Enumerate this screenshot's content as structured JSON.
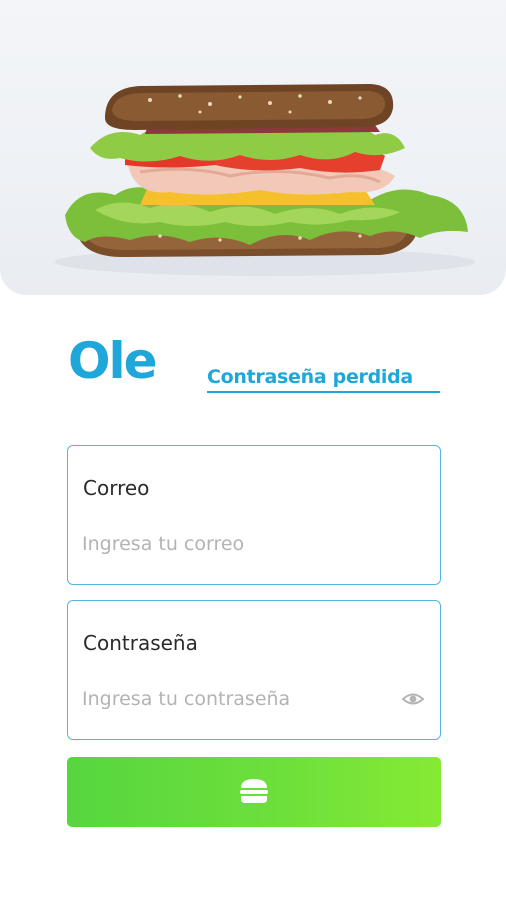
{
  "hero": {
    "image": "sandwich-photo"
  },
  "brand": {
    "logo": "Ole"
  },
  "links": {
    "lost_password": "Contraseña perdida"
  },
  "form": {
    "email": {
      "label": "Correo",
      "placeholder": "Ingresa tu correo",
      "value": ""
    },
    "password": {
      "label": "Contraseña",
      "placeholder": "Ingresa tu contraseña",
      "value": "",
      "toggle_icon": "eye-icon"
    },
    "submit": {
      "icon": "burger-icon"
    }
  },
  "colors": {
    "accent": "#1ea7d8",
    "field_border": "#57b4de",
    "button_start": "#56d63f",
    "button_end": "#86ea34",
    "placeholder": "#b3b3b3"
  }
}
